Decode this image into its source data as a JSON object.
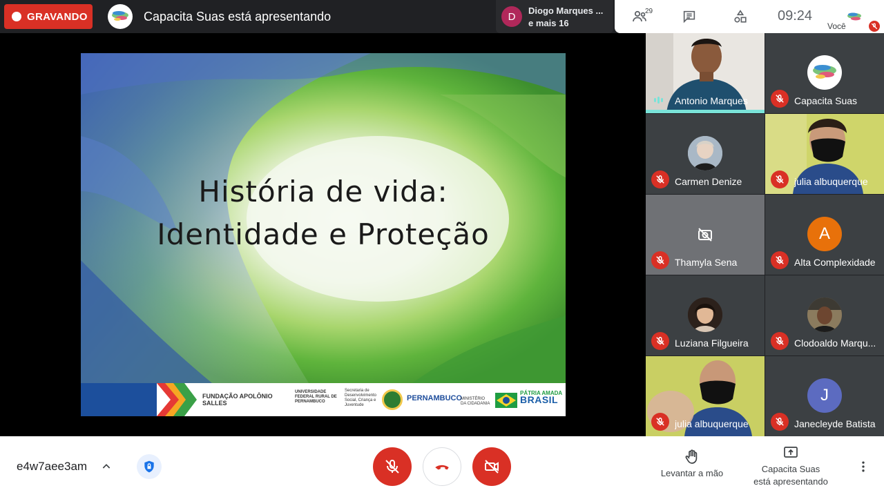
{
  "recording": {
    "label": "GRAVANDO"
  },
  "header": {
    "presenting_title": "Capacita Suas está apresentando",
    "active_speaker": {
      "initial": "D",
      "name": "Diogo Marques ...",
      "more": "e mais 16"
    },
    "people_count": "29",
    "time": "09:24",
    "self_label": "Você"
  },
  "slide": {
    "title_line1": "História de vida:",
    "title_line2": "Identidade e Proteção",
    "footer_logos": {
      "fundacao": "FUNDAÇÃO APOLÔNIO SALLES",
      "ufrpe": "UNIVERSIDADE FEDERAL RURAL DE PERNAMBUCO",
      "secretaria": "Secretaria de Desenvolvimento Social, Criança e Juventude",
      "pernambuco": "PERNAMBUCO",
      "ministerio": "MINISTÉRIO DA CIDADANIA",
      "patria": "PÁTRIA AMADA",
      "brasil": "BRASIL"
    }
  },
  "participants": [
    {
      "name": "Antonio Marques",
      "type": "video-man",
      "speaking": true
    },
    {
      "name": "Capacita Suas",
      "type": "logo",
      "muted": true
    },
    {
      "name": "Carmen Denize",
      "type": "photo",
      "muted": true
    },
    {
      "name": "julia albuquerque",
      "type": "video-mask",
      "muted": true
    },
    {
      "name": "Thamyla Sena",
      "type": "camera-off",
      "muted": true
    },
    {
      "name": "Alta Complexidade",
      "type": "initial",
      "initial": "A",
      "color": "#e8710a",
      "muted": true
    },
    {
      "name": "Luziana Filgueira",
      "type": "photo",
      "muted": true
    },
    {
      "name": "Clodoaldo Marqu...",
      "type": "photo",
      "muted": true
    },
    {
      "name": "julia albuquerque",
      "type": "video-mask",
      "muted": true
    },
    {
      "name": "Janecleyde Batista",
      "type": "initial",
      "initial": "J",
      "color": "#5c6bc0",
      "muted": true
    }
  ],
  "bottom": {
    "meeting_code": "e4w7aee3am",
    "raise_hand": "Levantar a mão",
    "presenting_line1": "Capacita Suas",
    "presenting_line2": "está apresentando"
  },
  "colors": {
    "record_red": "#d93025",
    "speaking_teal": "#7ae3d9",
    "bg_dark": "#202124"
  }
}
